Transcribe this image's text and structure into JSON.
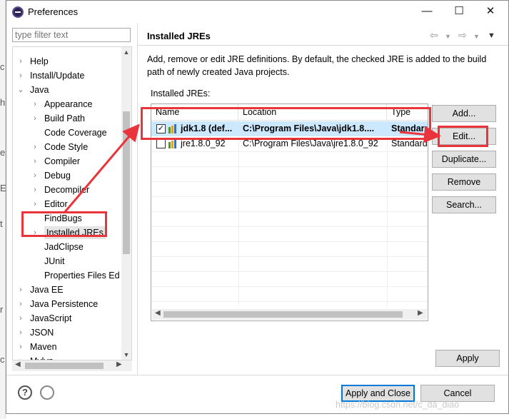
{
  "window": {
    "title": "Preferences",
    "minimize_glyph": "—",
    "maximize_glyph": "☐",
    "close_glyph": "✕"
  },
  "filter": {
    "placeholder": "type filter text"
  },
  "tree": {
    "items": [
      {
        "label": "Help",
        "level": 0,
        "twisty": "›"
      },
      {
        "label": "Install/Update",
        "level": 0,
        "twisty": "›"
      },
      {
        "label": "Java",
        "level": 0,
        "twisty": "⌄"
      },
      {
        "label": "Appearance",
        "level": 1,
        "twisty": "›"
      },
      {
        "label": "Build Path",
        "level": 1,
        "twisty": "›"
      },
      {
        "label": "Code Coverage",
        "level": 1,
        "twisty": ""
      },
      {
        "label": "Code Style",
        "level": 1,
        "twisty": "›"
      },
      {
        "label": "Compiler",
        "level": 1,
        "twisty": "›"
      },
      {
        "label": "Debug",
        "level": 1,
        "twisty": "›"
      },
      {
        "label": "Decompiler",
        "level": 1,
        "twisty": "›"
      },
      {
        "label": "Editor",
        "level": 1,
        "twisty": "›"
      },
      {
        "label": "FindBugs",
        "level": 1,
        "twisty": ""
      },
      {
        "label": "Installed JREs",
        "level": 1,
        "twisty": "›",
        "selected": true
      },
      {
        "label": "JadClipse",
        "level": 1,
        "twisty": ""
      },
      {
        "label": "JUnit",
        "level": 1,
        "twisty": ""
      },
      {
        "label": "Properties Files Ed",
        "level": 1,
        "twisty": ""
      },
      {
        "label": "Java EE",
        "level": 0,
        "twisty": "›"
      },
      {
        "label": "Java Persistence",
        "level": 0,
        "twisty": "›"
      },
      {
        "label": "JavaScript",
        "level": 0,
        "twisty": "›"
      },
      {
        "label": "JSON",
        "level": 0,
        "twisty": "›"
      },
      {
        "label": "Maven",
        "level": 0,
        "twisty": "›"
      },
      {
        "label": "Mylyn",
        "level": 0,
        "twisty": "›"
      }
    ]
  },
  "page": {
    "title": "Installed JREs",
    "description": "Add, remove or edit JRE definitions. By default, the checked JRE is added to the build path of newly created Java projects.",
    "list_label": "Installed JREs:"
  },
  "table": {
    "columns": [
      "Name",
      "Location",
      "Type"
    ],
    "rows": [
      {
        "name": "jdk1.8 (def...",
        "location": "C:\\Program Files\\Java\\jdk1.8....",
        "type": "Standard",
        "checked": true,
        "selected": true
      },
      {
        "name": "jre1.8.0_92",
        "location": "C:\\Program Files\\Java\\jre1.8.0_92",
        "type": "Standard",
        "checked": false,
        "selected": false
      }
    ]
  },
  "buttons": {
    "add": "Add...",
    "edit": "Edit...",
    "duplicate": "Duplicate...",
    "remove": "Remove",
    "search": "Search...",
    "apply": "Apply",
    "apply_close": "Apply and Close",
    "cancel": "Cancel",
    "help": "?"
  },
  "colors": {
    "annotation_red": "#e8343a",
    "selection_blue": "#cce8ff",
    "default_button_border": "#0078d7"
  },
  "watermark": "https://blog.csdn.net/c_da_diao"
}
